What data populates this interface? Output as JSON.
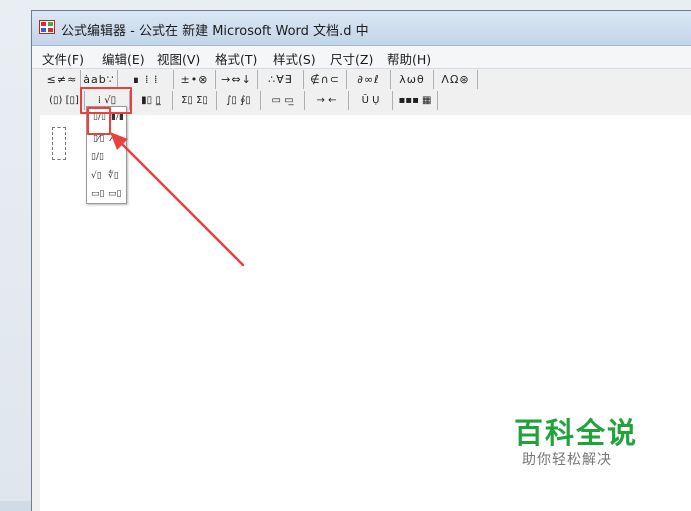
{
  "window": {
    "title": "公式编辑器 - 公式在 新建 Microsoft Word 文档.d 中"
  },
  "menu": [
    {
      "label": "文件(F)"
    },
    {
      "label": "编辑(E)"
    },
    {
      "label": "视图(V)"
    },
    {
      "label": "格式(T)"
    },
    {
      "label": "样式(S)"
    },
    {
      "label": "尺寸(Z)"
    },
    {
      "label": "帮助(H)"
    }
  ],
  "toolbar_row1": [
    {
      "label": "≤≠≈",
      "icon": "relational-symbols-icon"
    },
    {
      "label": "ȧab∵",
      "icon": "spaces-ellipses-icon"
    },
    {
      "label": "∎ ⁞ ⁞",
      "icon": "embellishments-icon"
    },
    {
      "label": "±•⊗",
      "icon": "operator-symbols-icon"
    },
    {
      "label": "→⇔↓",
      "icon": "arrow-symbols-icon"
    },
    {
      "label": "∴∀∃",
      "icon": "logical-symbols-icon"
    },
    {
      "label": "∉∩⊂",
      "icon": "set-theory-symbols-icon"
    },
    {
      "label": "∂∞ℓ",
      "icon": "misc-symbols-icon"
    },
    {
      "label": "λωθ",
      "icon": "greek-lowercase-icon"
    },
    {
      "label": "ΛΩ⊛",
      "icon": "greek-uppercase-icon"
    }
  ],
  "toolbar_row2": [
    {
      "label": "(▯) [▯]",
      "icon": "fence-templates-icon"
    },
    {
      "label": "⁞ √▯",
      "icon": "fraction-radical-templates-icon"
    },
    {
      "label": "▮▯ ▯̲",
      "icon": "subscript-superscript-templates-icon"
    },
    {
      "label": "Σ▯ Σ▯",
      "icon": "summation-templates-icon"
    },
    {
      "label": "∫▯ ∮▯",
      "icon": "integral-templates-icon"
    },
    {
      "label": "▭ ▭̲",
      "icon": "underbar-overbar-templates-icon"
    },
    {
      "label": "→ ←",
      "icon": "labeled-arrow-templates-icon"
    },
    {
      "label": "Ū Ụ",
      "icon": "products-set-theory-templates-icon"
    },
    {
      "label": "▪▪▪ ▦",
      "icon": "matrix-templates-icon"
    }
  ],
  "palette": [
    {
      "label": "▯/▯",
      "icon": "full-size-fraction-icon"
    },
    {
      "label": "▮/▮",
      "icon": "reduced-fraction-icon"
    },
    {
      "label": "▯⁄▯",
      "icon": "slash-fraction-icon"
    },
    {
      "label": "⁄",
      "icon": "reduced-slash-fraction-icon"
    },
    {
      "label": "▯/▯",
      "icon": "special-slash-fraction-icon"
    },
    {
      "label": "√▯",
      "icon": "square-root-icon"
    },
    {
      "label": "∜▯",
      "icon": "nth-root-icon"
    },
    {
      "label": "▭▯",
      "icon": "long-division-icon"
    },
    {
      "label": "▭▯",
      "icon": "long-division-2-icon"
    }
  ],
  "watermark": {
    "main": "百科全说",
    "sub": "助你轻松解决"
  },
  "colors": {
    "highlight": "#e8423e",
    "watermark": "#21a33b",
    "arrow": "#e8423e"
  }
}
